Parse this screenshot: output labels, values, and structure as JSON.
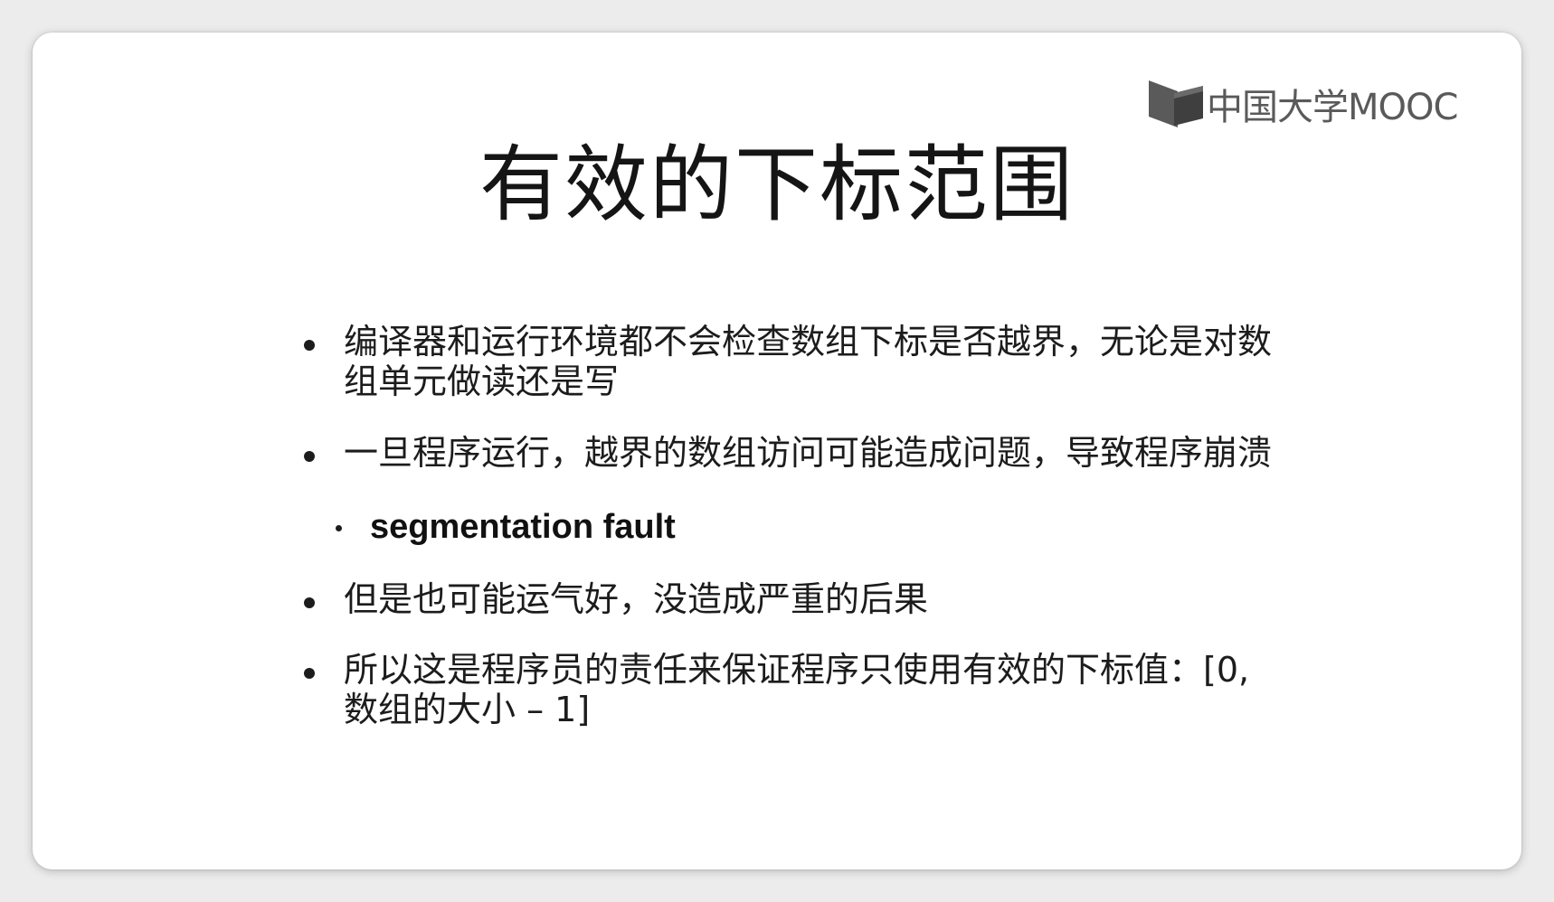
{
  "logo": {
    "icon": "mooc-book-icon",
    "text": "中国大学MOOC"
  },
  "slide": {
    "title": "有效的下标范围",
    "bullets": [
      "编译器和运行环境都不会检查数组下标是否越界，无论是对数组单元做读还是写",
      "一旦程序运行，越界的数组访问可能造成问题，导致程序崩溃"
    ],
    "sub_bullet": "segmentation fault",
    "bullets_after": [
      "但是也可能运气好，没造成严重的后果",
      "所以这是程序员的责任来保证程序只使用有效的下标值：[0,数组的大小 – 1]"
    ]
  }
}
